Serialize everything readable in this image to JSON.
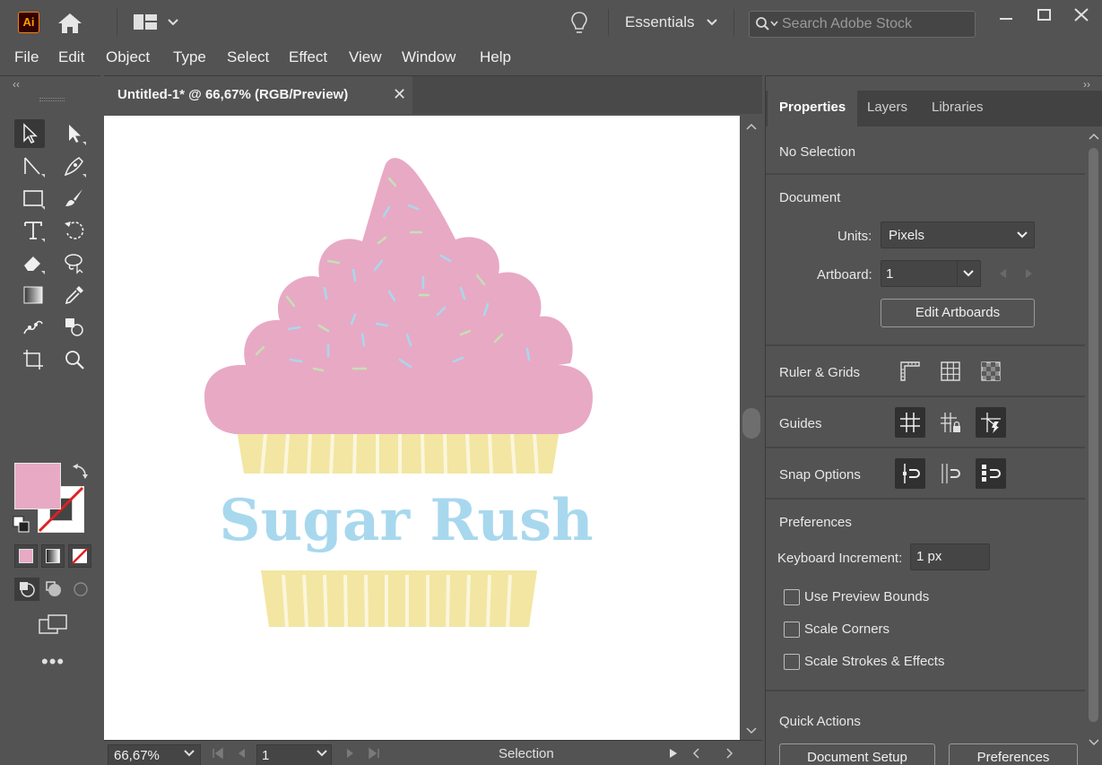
{
  "app": {
    "logo_text": "Ai",
    "workspace": "Essentials",
    "search_placeholder": "Search Adobe Stock"
  },
  "menu": [
    "File",
    "Edit",
    "Object",
    "Type",
    "Select",
    "Effect",
    "View",
    "Window",
    "Help"
  ],
  "document": {
    "tab_title": "Untitled-1* @ 66,67% (RGB/Preview)",
    "close_glyph": "✕",
    "artwork_text": "Sugar Rush"
  },
  "colors": {
    "fill": "#e8a9c5",
    "frosting": "#e8a9c5",
    "wrapper": "#f2e6a2",
    "text_blue": "#a8d8ee"
  },
  "statusbar": {
    "zoom": "66,67%",
    "page": "1",
    "tool": "Selection"
  },
  "panel": {
    "tabs": [
      "Properties",
      "Layers",
      "Libraries"
    ],
    "no_selection": "No Selection",
    "document_header": "Document",
    "units_label": "Units:",
    "units_value": "Pixels",
    "artboard_label": "Artboard:",
    "artboard_value": "1",
    "edit_artboards": "Edit Artboards",
    "ruler_grids": "Ruler & Grids",
    "guides": "Guides",
    "snap_options": "Snap Options",
    "preferences_header": "Preferences",
    "keyboard_increment_label": "Keyboard Increment:",
    "keyboard_increment_value": "1 px",
    "checkboxes": [
      "Use Preview Bounds",
      "Scale Corners",
      "Scale Strokes & Effects"
    ],
    "quick_actions": "Quick Actions",
    "document_setup": "Document Setup",
    "preferences_button": "Preferences"
  }
}
